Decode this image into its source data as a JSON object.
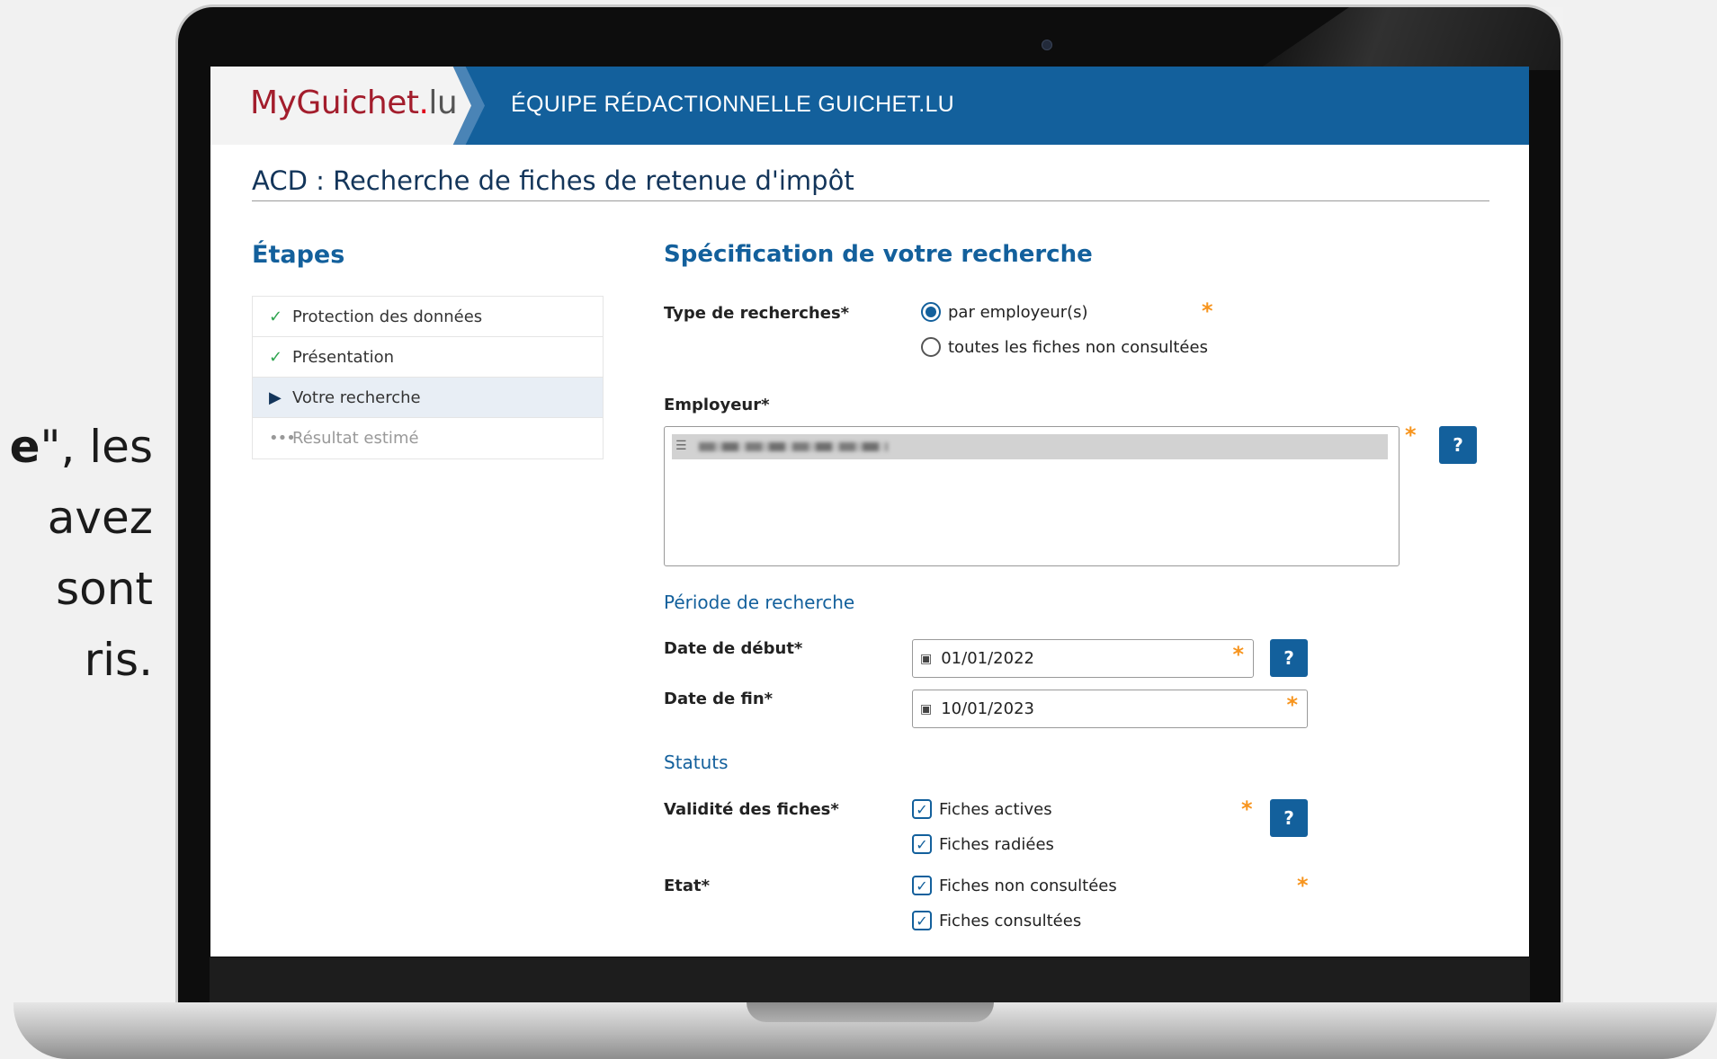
{
  "side_text": {
    "line1_bold": "e",
    "line1_rest": "\", les",
    "line2": "avez",
    "line3": "sont",
    "line4": "ris."
  },
  "header": {
    "logo_my": "MyGuichet",
    "logo_dot": ".",
    "logo_lu": "lu",
    "title": "ÉQUIPE RÉDACTIONNELLE GUICHET.LU",
    "brand_color": "#13609c"
  },
  "page_title": "ACD : Recherche de fiches de retenue d'impôt",
  "steps": {
    "title": "Étapes",
    "items": [
      {
        "label": "Protection des données",
        "status": "done",
        "icon": "check-icon"
      },
      {
        "label": "Présentation",
        "status": "done",
        "icon": "check-icon"
      },
      {
        "label": "Votre recherche",
        "status": "current",
        "icon": "arrow-right-icon"
      },
      {
        "label": "Résultat estimé",
        "status": "pending",
        "icon": "dots-icon"
      }
    ]
  },
  "form": {
    "section_title": "Spécification de votre recherche",
    "type_label": "Type de recherches*",
    "type_options": [
      {
        "label": "par employeur(s)",
        "selected": true
      },
      {
        "label": "toutes les fiches non consultées",
        "selected": false
      }
    ],
    "employer_label": "Employeur*",
    "period_title": "Période de recherche",
    "start_label": "Date de début*",
    "start_value": "01/01/2022",
    "end_label": "Date de fin*",
    "end_value": "10/01/2023",
    "status_title": "Statuts",
    "validity_label": "Validité des fiches*",
    "validity_options": [
      {
        "label": "Fiches actives",
        "checked": true
      },
      {
        "label": "Fiches radiées",
        "checked": true
      }
    ],
    "state_label": "Etat*",
    "state_options": [
      {
        "label": "Fiches non consultées",
        "checked": true
      },
      {
        "label": "Fiches consultées",
        "checked": true
      }
    ],
    "required_mark": "*",
    "help_label": "?"
  }
}
